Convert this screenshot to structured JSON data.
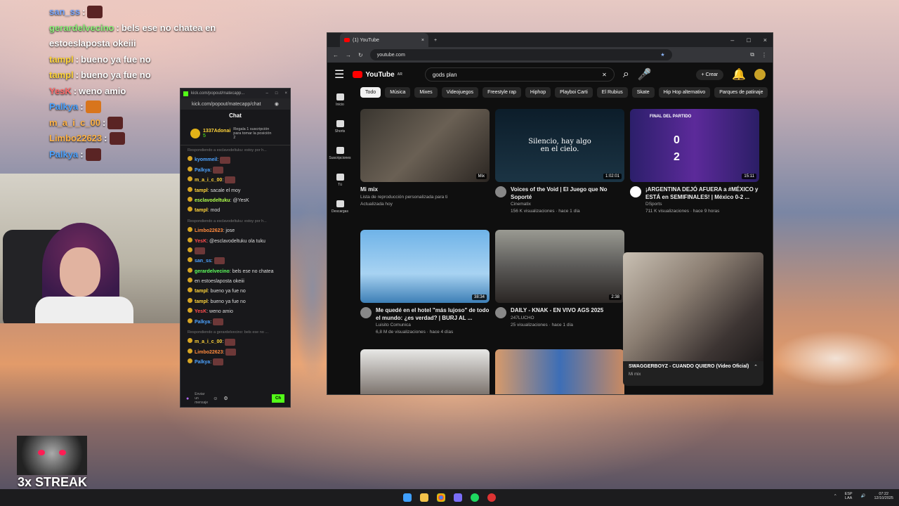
{
  "overlay_chat": [
    {
      "user": "san_ss",
      "sep": ":",
      "text": "",
      "color": "#7aa7ff"
    },
    {
      "user": "gerardelvecino",
      "sep": ":",
      "text": "bels ese no chatea en",
      "color": "#8df07a"
    },
    {
      "user": "",
      "sep": "",
      "text": "estoeslaposta okeiii",
      "color": "#fff"
    },
    {
      "user": "tampl",
      "sep": ":",
      "text": "bueno ya fue no",
      "color": "#ffd43b"
    },
    {
      "user": "tampl",
      "sep": ":",
      "text": "bueno ya fue no",
      "color": "#ffd43b"
    },
    {
      "user": "YesK",
      "sep": ":",
      "text": "weno amio",
      "color": "#ff6b6b"
    },
    {
      "user": "Palkya",
      "sep": ":",
      "text": "",
      "color": "#4da3ff"
    },
    {
      "user": "m_a_i_c_00",
      "sep": ":",
      "text": "",
      "color": "#ffb347"
    },
    {
      "user": "Limbo22623",
      "sep": ":",
      "text": "",
      "color": "#ffb347"
    },
    {
      "user": "Palkya",
      "sep": ":",
      "text": "",
      "color": "#4da3ff"
    }
  ],
  "streak": {
    "label": "3x STREAK"
  },
  "kick": {
    "window_url_short": "kick.com/popout/matecapp...",
    "url": "kick.com/popout/matecapp/chat",
    "title": "Chat",
    "pinned_user": "1337Adonai",
    "pinned_count": "5",
    "pinned_text": "Regala 1 suscripción para tomar la posición 2",
    "messages": [
      {
        "kind": "reply",
        "text": "Respondiendo a esclavodeltuku: estoy por h..."
      },
      {
        "user": "kyommeil",
        "cls": "u1",
        "text": ""
      },
      {
        "user": "Palkya",
        "cls": "u1",
        "text": ""
      },
      {
        "user": "m_a_i_c_00",
        "cls": "u3",
        "text": ""
      },
      {
        "user": "tampl",
        "cls": "u3",
        "text": "sacale el moy"
      },
      {
        "user": "esclavodeltuku",
        "cls": "u5",
        "text": "@YesK"
      },
      {
        "user": "tampl",
        "cls": "u3",
        "text": "mod"
      },
      {
        "kind": "reply",
        "text": "Respondiendo a esclavodeltuku: estoy por h..."
      },
      {
        "user": "Limbo22623",
        "cls": "u2",
        "text": "jose"
      },
      {
        "user": "YesK",
        "cls": "u4",
        "text": "@esclavodeltuku ola tuku"
      },
      {
        "user": "",
        "cls": "u1",
        "text": ""
      },
      {
        "user": "san_ss",
        "cls": "u1",
        "text": ""
      },
      {
        "user": "gerardelvecino",
        "cls": "u7",
        "text": "bels ese no chatea"
      },
      {
        "user": "",
        "cls": "u1",
        "text": "en estoeslaposta okeiii"
      },
      {
        "user": "tampl",
        "cls": "u3",
        "text": "bueno ya fue no"
      },
      {
        "user": "tampl",
        "cls": "u3",
        "text": "bueno ya fue no"
      },
      {
        "user": "YesK",
        "cls": "u4",
        "text": "weno amio"
      },
      {
        "user": "Palkya",
        "cls": "u1",
        "text": ""
      },
      {
        "kind": "reply",
        "text": "Respondiendo a gerardelvecino: bels ese no ..."
      },
      {
        "user": "m_a_i_c_00",
        "cls": "u3",
        "text": ""
      },
      {
        "user": "Limbo22623",
        "cls": "u2",
        "text": ""
      },
      {
        "user": "Palkya",
        "cls": "u1",
        "text": ""
      }
    ],
    "input_placeholder": "Enviar un mensaje",
    "send_label": "Ch"
  },
  "chrome": {
    "tab_title": "(1) YouTube",
    "url": "youtube.com"
  },
  "youtube": {
    "logo": "YouTube",
    "logo_region": "AR",
    "search_query": "gods plan",
    "create_label": "Crear",
    "sidebar": [
      "Inicio",
      "Shorts",
      "Suscripciones",
      "Tú",
      "Descargas"
    ],
    "chips": [
      "Todo",
      "Música",
      "Mixes",
      "Videojuegos",
      "Freestyle rap",
      "Hiphop",
      "Playboi Carti",
      "El Rubius",
      "Skate",
      "Hip Hop alternativo",
      "Parques de patinaje"
    ],
    "videos": [
      {
        "title": "Mi mix",
        "channel": "Lista de reproducción personalizada para ti",
        "meta": "Actualizada hoy",
        "duration": "Mix"
      },
      {
        "title": "Voices of the Void | El Juego que No Soporté",
        "channel": "Cinematix",
        "meta": "156 K visualizaciones · hace 1 día",
        "duration": "1:02:01",
        "thumb_text": "Silencio, hay algo en el cielo."
      },
      {
        "title": "¡ARGENTINA DEJÓ AFUERA a #MÉXICO y ESTÁ en SEMIFINALES! | México 0-2 ...",
        "channel": "DSports",
        "meta": "711 K visualizaciones · hace 9 horas",
        "duration": "15:11",
        "thumb_text": "FINAL DEL PARTIDO",
        "score_a": "0",
        "score_b": "2"
      },
      {
        "title": "Me quedé en el hotel \"más lujoso\" de todo el mundo: ¿es verdad? | BURJ AL ...",
        "channel": "Luisito Comunica",
        "meta": "6,8 M de visualizaciones · hace 4 días",
        "duration": "38:34"
      },
      {
        "title": "DAILY - KNAK - EN VIVO AGS 2025",
        "channel": "247LUCHO",
        "meta": "25 visualizaciones · hace 1 día",
        "duration": "2:38"
      }
    ],
    "miniplayer": {
      "title": "SWAGGERBOYZ - CUANDO QUIERO (Video Oficial)",
      "subtitle": "Mi mix"
    }
  },
  "tray": {
    "lang": "ESP",
    "layout": "LAA",
    "time": "07:22",
    "date": "12/10/2025"
  }
}
